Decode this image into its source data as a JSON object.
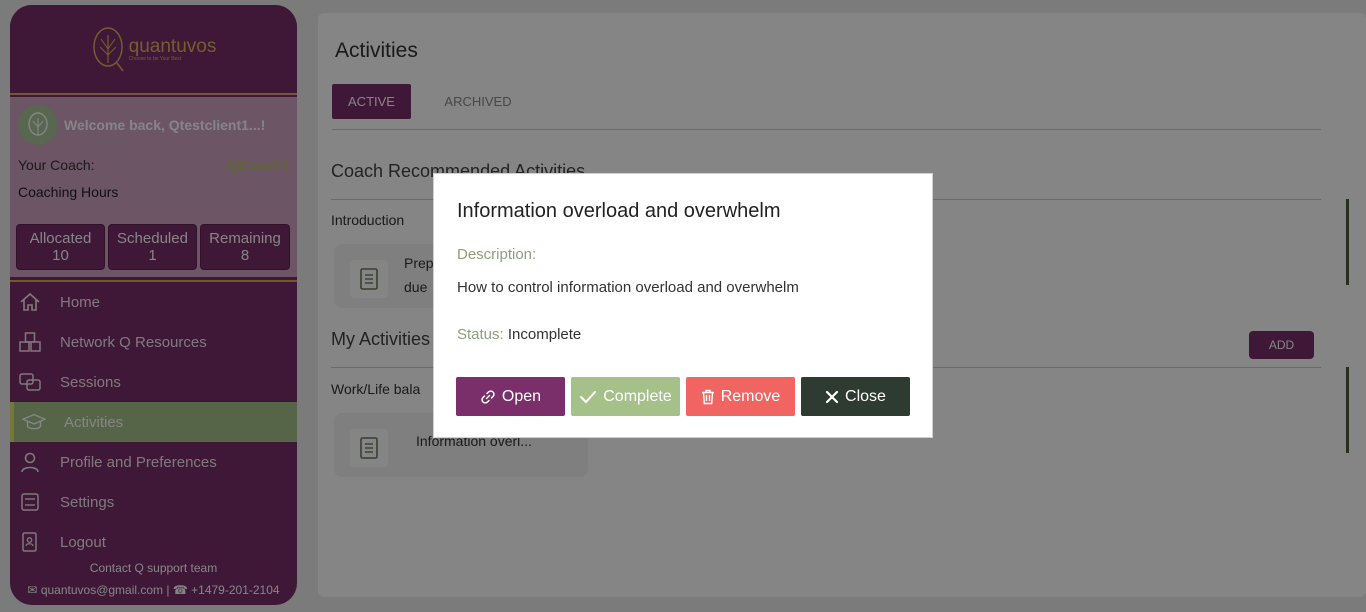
{
  "brand": {
    "name": "quantuvos",
    "tagline": "Choose to be Your Best"
  },
  "profile": {
    "welcome": "Welcome back, Qtestclient1...!",
    "coach_label": "Your Coach:",
    "coach_name": "QCoach1",
    "hours_label": "Coaching Hours",
    "stats": [
      {
        "label": "Allocated",
        "value": "10"
      },
      {
        "label": "Scheduled",
        "value": "1"
      },
      {
        "label": "Remaining",
        "value": "8"
      }
    ]
  },
  "nav": [
    {
      "label": "Home",
      "icon": "home-icon"
    },
    {
      "label": "Network Q Resources",
      "icon": "network-icon"
    },
    {
      "label": "Sessions",
      "icon": "sessions-icon"
    },
    {
      "label": "Activities",
      "icon": "graduation-cap-icon",
      "active": true
    },
    {
      "label": "Profile and Preferences",
      "icon": "user-icon"
    },
    {
      "label": "Settings",
      "icon": "settings-icon"
    },
    {
      "label": "Logout",
      "icon": "logout-icon"
    }
  ],
  "footer": {
    "support": "Contact Q support team",
    "email": "quantuvos@gmail.com",
    "phone": "+1479-201-2104"
  },
  "main": {
    "title": "Activities",
    "tabs": [
      "ACTIVE",
      "ARCHIVED"
    ],
    "coach_section": "Coach Recommended Activities",
    "intro_label": "Introduction",
    "intro_card_line1": "Prep",
    "intro_card_line2": "due",
    "my_section": "My Activities",
    "add_label": "ADD",
    "work_label": "Work/Life bala",
    "work_card": "Information overl..."
  },
  "modal": {
    "title": "Information overload and overwhelm",
    "desc_label": "Description:",
    "desc_text": "How to control information overload and overwhelm",
    "status_label": "Status:",
    "status_value": "Incomplete",
    "buttons": {
      "open": "Open",
      "complete": "Complete",
      "remove": "Remove",
      "close": "Close"
    }
  },
  "colors": {
    "primary": "#7a2f6a",
    "accent_green": "#a6c08a",
    "danger": "#f06562",
    "dark": "#2e3b30",
    "gold": "#d9a95b"
  }
}
